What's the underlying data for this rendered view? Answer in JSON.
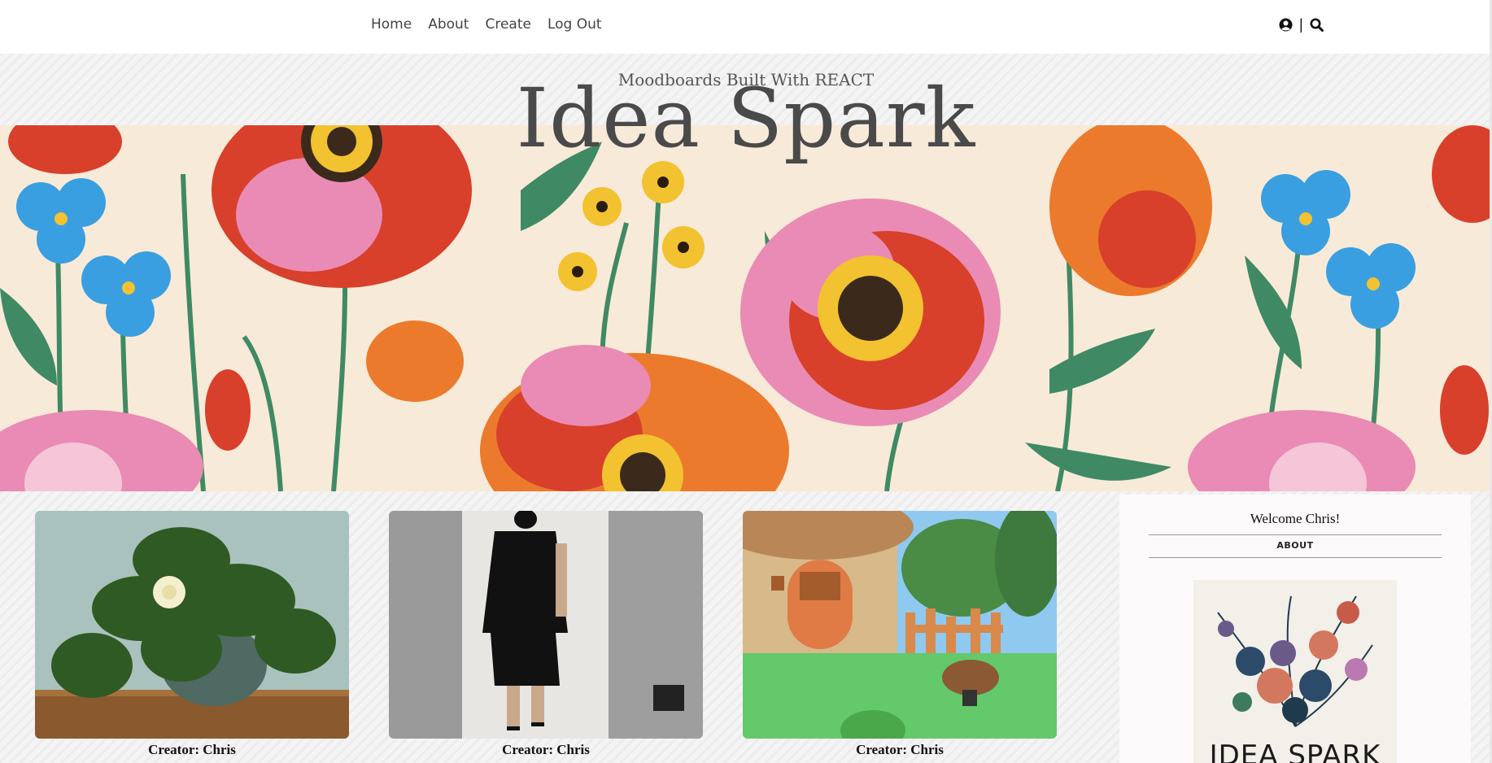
{
  "nav": {
    "links": [
      "Home",
      "About",
      "Create",
      "Log Out"
    ],
    "separator": "|",
    "user_icon": "user-circle-icon",
    "search_icon": "search-icon"
  },
  "header": {
    "tagline": "Moodboards Built With REACT",
    "title": "Idea Spark"
  },
  "cards": [
    {
      "creator": "Creator: Chris",
      "image": "gardenia-plant"
    },
    {
      "creator": "Creator: Chris",
      "image": "black-outfit"
    },
    {
      "creator": "Creator: Chris",
      "image": "animal-crossing-house"
    }
  ],
  "sidebar": {
    "welcome": "Welcome Chris!",
    "about_label": "ABOUT",
    "about_image_text": "IDEA SPARK"
  },
  "colors": {
    "banner_bg": "#f8ead8",
    "poppy_red": "#d8402b",
    "poppy_orange": "#ec7a2c",
    "poppy_pink": "#e98bb4",
    "flower_blue": "#3a9fe0",
    "leaf_green": "#3f8a64"
  }
}
